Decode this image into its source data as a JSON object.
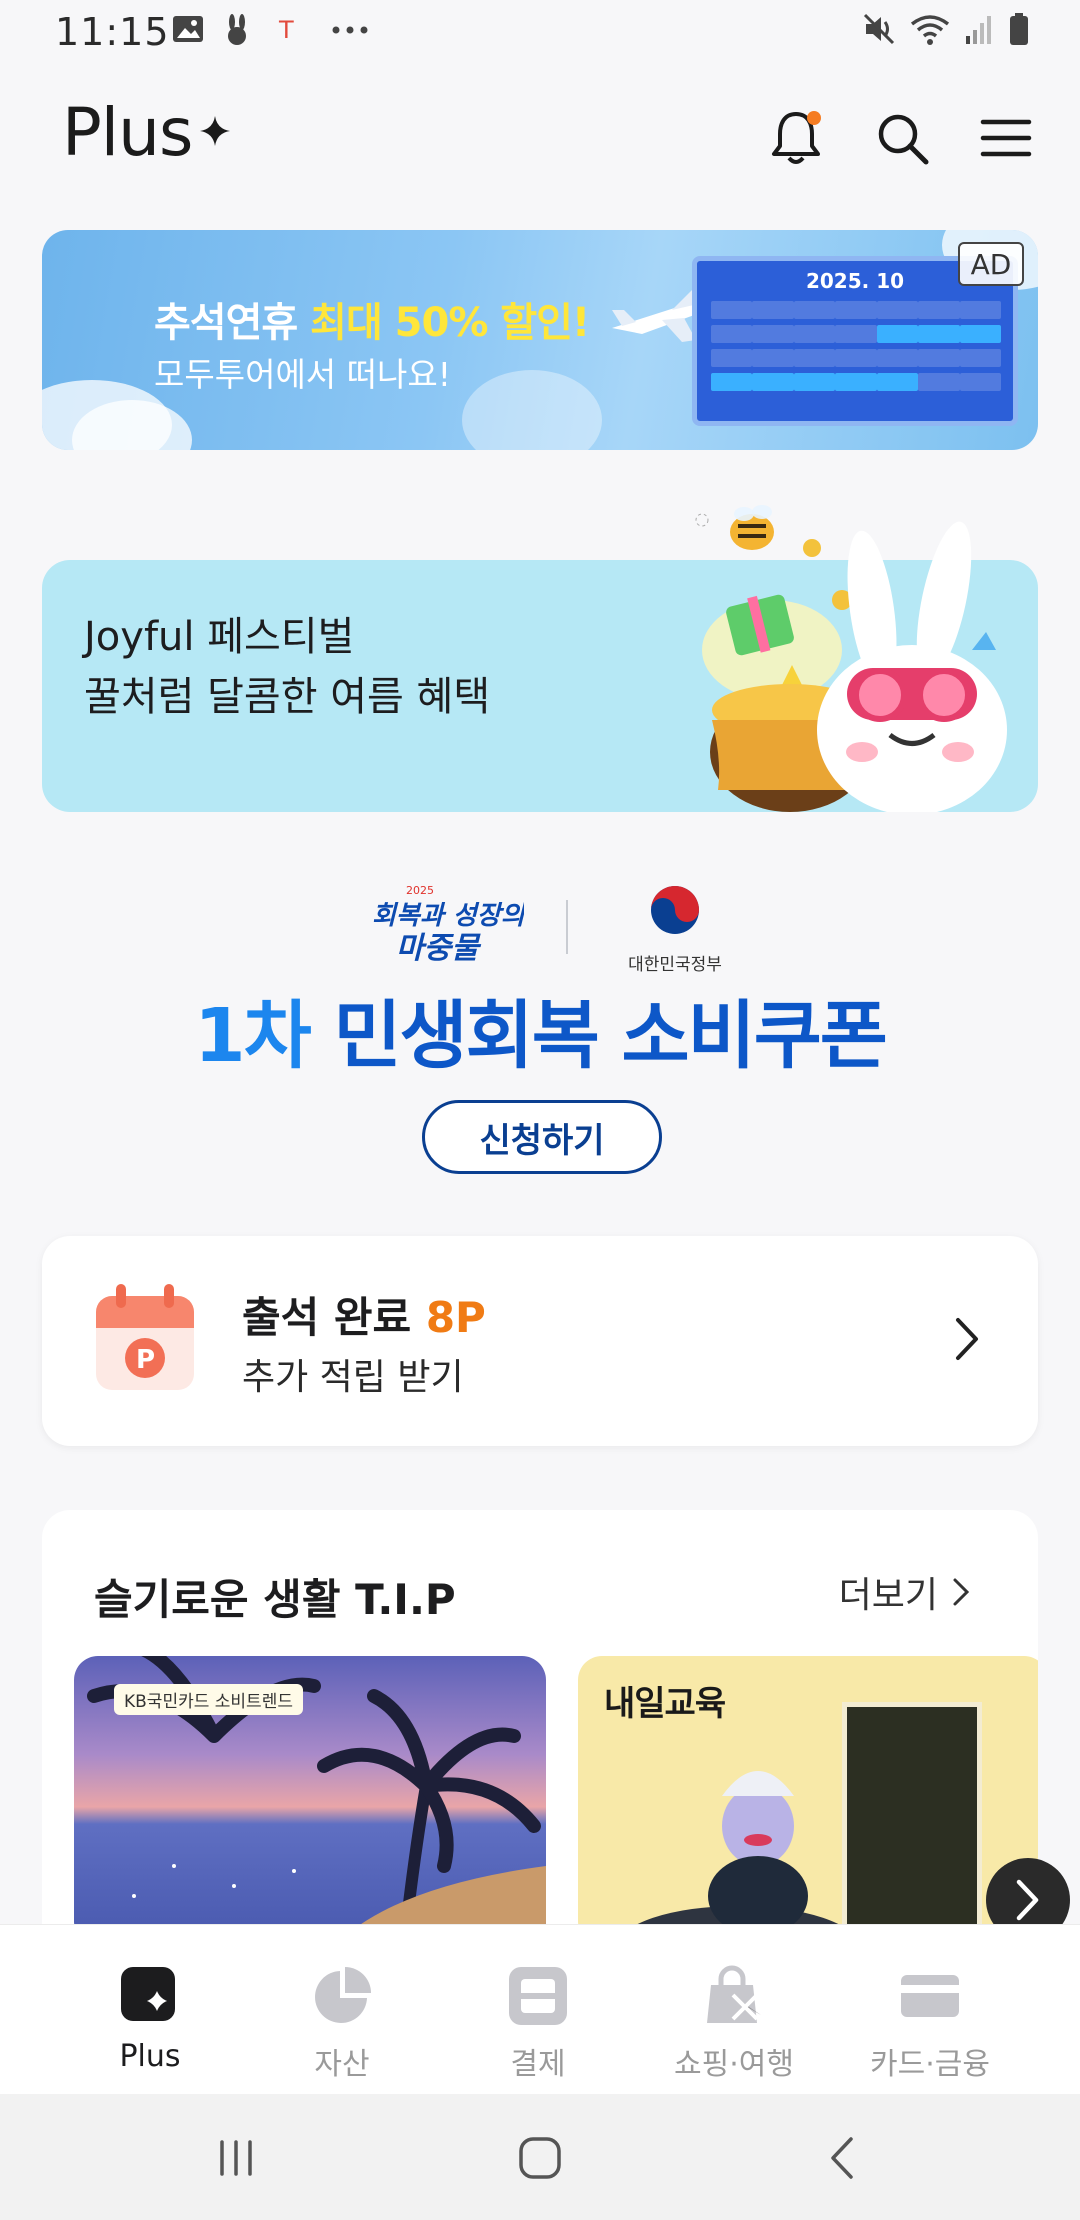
{
  "status_bar": {
    "time": "11:15"
  },
  "header": {
    "title": "Plus"
  },
  "ad_banner": {
    "title_prefix": "추석연휴 ",
    "title_highlight": "최대 50% 할인!",
    "subtitle": "모두투어에서 떠나요!",
    "ad_label": "AD",
    "board_title": "2025. 10"
  },
  "joy_banner": {
    "line1": "Joyful 페스티벌",
    "line2": "꿀처럼 달콤한 여름 혜택"
  },
  "coupon": {
    "gov_label": "대한민국정부",
    "title_number": "1차",
    "title_text": " 민생회복 소비쿠폰",
    "apply_label": "신청하기"
  },
  "attendance": {
    "title": "출석 완료 ",
    "points": "8P",
    "subtitle": "추가 적립 받기"
  },
  "tips": {
    "title": "슬기로운 생활 T.I.P",
    "more_label": "더보기",
    "items": [
      {
        "badge": "KB국민카드 소비트렌드"
      },
      {
        "brand": "내일교육"
      }
    ]
  },
  "bottom_nav": {
    "items": [
      {
        "label": "Plus",
        "icon": "plus-sparkle-icon"
      },
      {
        "label": "자산",
        "icon": "pie-chart-icon"
      },
      {
        "label": "결제",
        "icon": "scan-icon"
      },
      {
        "label": "쇼핑·여행",
        "icon": "shopping-bag-icon"
      },
      {
        "label": "카드·금융",
        "icon": "card-icon"
      }
    ]
  },
  "colors": {
    "accent_blue": "#0d57c8",
    "points_orange": "#f07b14",
    "notification_dot": "#f57c22"
  }
}
